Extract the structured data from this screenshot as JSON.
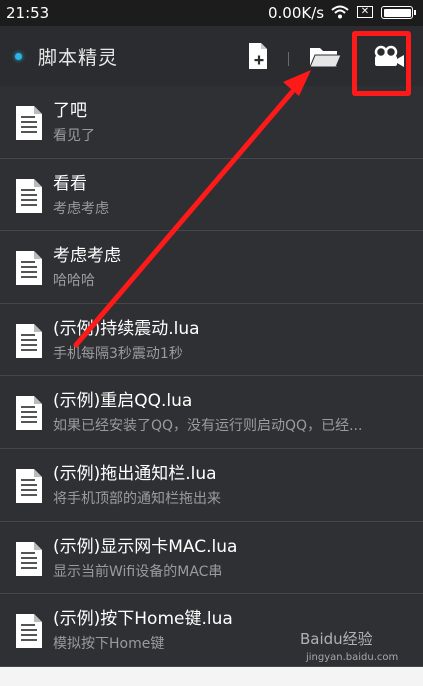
{
  "status_bar": {
    "time": "21:53",
    "speed": "0.00K/s",
    "sim": "✕"
  },
  "toolbar": {
    "title": "脚本精灵",
    "icons": [
      "new-file-icon",
      "folder-icon",
      "recorder-icon"
    ]
  },
  "scripts": [
    {
      "name": "了吧",
      "desc": "看见了"
    },
    {
      "name": "看看",
      "desc": "考虑考虑"
    },
    {
      "name": "考虑考虑",
      "desc": "哈哈哈"
    },
    {
      "name": "(示例)持续震动.lua",
      "desc": "手机每隔3秒震动1秒"
    },
    {
      "name": "(示例)重启QQ.lua",
      "desc": "如果已经安装了QQ，没有运行则启动QQ，已经..."
    },
    {
      "name": "(示例)拖出通知栏.lua",
      "desc": "将手机顶部的通知栏拖出来"
    },
    {
      "name": "(示例)显示网卡MAC.lua",
      "desc": "显示当前Wifi设备的MAC串"
    },
    {
      "name": "(示例)按下Home键.lua",
      "desc": "模拟按下Home键"
    }
  ],
  "watermark": {
    "text": "Baidu经验",
    "sub": "jingyan.baidu.com"
  },
  "colors": {
    "accent_dot": "#2bb4e8",
    "annotation_red": "#ff1a1a",
    "background": "#2f3033"
  }
}
